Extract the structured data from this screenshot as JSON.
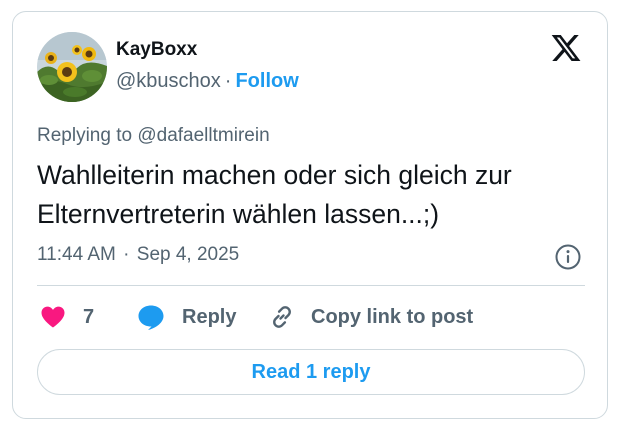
{
  "author": {
    "display_name": "KayBoxx",
    "handle": "@kbuschox",
    "separator": "·",
    "follow_label": "Follow"
  },
  "brand": {
    "logo_icon": "x-logo-icon"
  },
  "tweet": {
    "replying_prefix": "Replying to",
    "replying_to": "@dafaelltmirein",
    "text": "Wahlleiterin machen oder sich gleich zur Elternvertreterin wählen lassen...;)",
    "time": "11:44 AM",
    "separator": "·",
    "date": "Sep 4, 2025"
  },
  "actions": {
    "like_count": "7",
    "reply_label": "Reply",
    "copy_label": "Copy link to post",
    "read_replies_label": "Read 1 reply"
  },
  "colors": {
    "accent": "#1d9bf0",
    "like": "#f91880",
    "text": "#0f1419",
    "secondary": "#536471",
    "border": "#cfd9de"
  }
}
